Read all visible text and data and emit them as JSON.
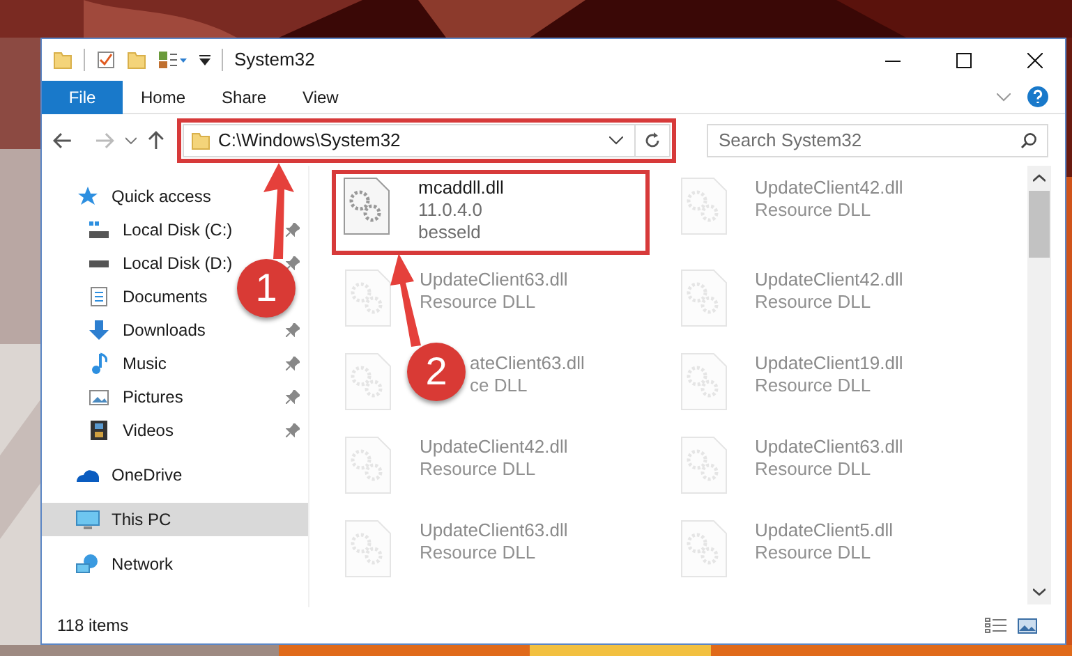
{
  "window": {
    "title": "System32"
  },
  "ribbon_tabs": [
    {
      "label": "File",
      "kind": "file"
    },
    {
      "label": "Home",
      "kind": "tab"
    },
    {
      "label": "Share",
      "kind": "tab"
    },
    {
      "label": "View",
      "kind": "tab"
    }
  ],
  "address_bar": {
    "path": "C:\\Windows\\System32",
    "highlighted": true
  },
  "search": {
    "placeholder": "Search System32"
  },
  "nav": [
    {
      "label": "Quick access",
      "kind": "star",
      "selected": false,
      "children": [
        {
          "label": "Local Disk (C:)",
          "kind": "system-drive",
          "selected": false,
          "pinned": true
        },
        {
          "label": "Local Disk (D:)",
          "kind": "drive",
          "selected": false,
          "pinned": true
        },
        {
          "label": "Documents",
          "kind": "documents",
          "selected": false,
          "pinned": false
        },
        {
          "label": "Downloads",
          "kind": "downloads",
          "selected": false,
          "pinned": true
        },
        {
          "label": "Music",
          "kind": "music",
          "selected": false,
          "pinned": true
        },
        {
          "label": "Pictures",
          "kind": "pictures",
          "selected": false,
          "pinned": true
        },
        {
          "label": "Videos",
          "kind": "videos",
          "selected": false,
          "pinned": true
        }
      ]
    },
    {
      "label": "OneDrive",
      "kind": "cloud",
      "selected": false
    },
    {
      "label": "This PC",
      "kind": "pc",
      "selected": true
    },
    {
      "label": "Network",
      "kind": "network",
      "selected": false
    }
  ],
  "files": [
    {
      "name": "mcaddll.dll",
      "details": [
        "11.0.4.0",
        "besseld"
      ],
      "faded": false,
      "highlighted": true,
      "covered": false
    },
    {
      "name": "UpdateClient42.dll",
      "details": [
        "Resource DLL"
      ],
      "faded": true,
      "highlighted": false,
      "covered": false
    },
    {
      "name": "UpdateClient63.dll",
      "details": [
        "Resource DLL"
      ],
      "faded": true,
      "highlighted": false,
      "covered": false
    },
    {
      "name": "UpdateClient42.dll",
      "details": [
        "Resource DLL"
      ],
      "faded": true,
      "highlighted": false,
      "covered": false
    },
    {
      "name": "ateClient63.dll",
      "details": [
        "ce DLL"
      ],
      "faded": true,
      "highlighted": false,
      "covered": true
    },
    {
      "name": "UpdateClient19.dll",
      "details": [
        "Resource DLL"
      ],
      "faded": true,
      "highlighted": false,
      "covered": false
    },
    {
      "name": "UpdateClient42.dll",
      "details": [
        "Resource DLL"
      ],
      "faded": true,
      "highlighted": false,
      "covered": false
    },
    {
      "name": "UpdateClient63.dll",
      "details": [
        "Resource DLL"
      ],
      "faded": true,
      "highlighted": false,
      "covered": false
    },
    {
      "name": "UpdateClient63.dll",
      "details": [
        "Resource DLL"
      ],
      "faded": true,
      "highlighted": false,
      "covered": false
    },
    {
      "name": "UpdateClient5.dll",
      "details": [
        "Resource DLL"
      ],
      "faded": true,
      "highlighted": false,
      "covered": false
    }
  ],
  "status_bar": {
    "count": "118 items"
  },
  "callouts": [
    {
      "number": "1"
    },
    {
      "number": "2"
    }
  ]
}
